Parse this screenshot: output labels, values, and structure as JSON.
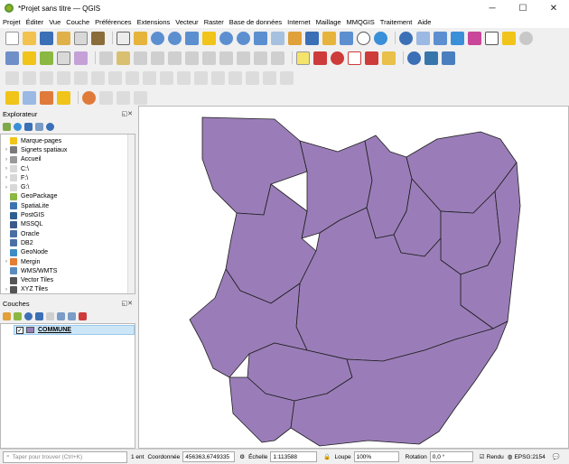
{
  "window": {
    "title": "*Projet sans titre — QGIS",
    "controls": {
      "minimize": "─",
      "maximize": "☐",
      "close": "✕"
    }
  },
  "menu": [
    "Projet",
    "Éditer",
    "Vue",
    "Couche",
    "Préférences",
    "Extensions",
    "Vecteur",
    "Raster",
    "Base de données",
    "Internet",
    "Maillage",
    "MMQGIS",
    "Traitement",
    "Aide"
  ],
  "explorer": {
    "title": "Explorateur",
    "items": [
      {
        "label": "Marque-pages",
        "arrow": "",
        "icon": "star-icon",
        "color": "#f0c419"
      },
      {
        "label": "Signets spatiaux",
        "arrow": "›",
        "icon": "bookmark-icon",
        "color": "#7a7a7a"
      },
      {
        "label": "Accueil",
        "arrow": "›",
        "icon": "home-folder-icon",
        "color": "#9a9a9a"
      },
      {
        "label": "C:\\",
        "arrow": "›",
        "icon": "drive-icon",
        "color": "#d8d8d8"
      },
      {
        "label": "F:\\",
        "arrow": "›",
        "icon": "drive-icon",
        "color": "#d8d8d8"
      },
      {
        "label": "G:\\",
        "arrow": "›",
        "icon": "drive-icon",
        "color": "#d8d8d8"
      },
      {
        "label": "GeoPackage",
        "arrow": "",
        "icon": "geopackage-icon",
        "color": "#8bb842"
      },
      {
        "label": "SpatiaLite",
        "arrow": "",
        "icon": "spatialite-icon",
        "color": "#3d74b0"
      },
      {
        "label": "PostGIS",
        "arrow": "",
        "icon": "postgis-icon",
        "color": "#2f5f8f"
      },
      {
        "label": "MSSQL",
        "arrow": "",
        "icon": "mssql-icon",
        "color": "#3b5a8a"
      },
      {
        "label": "Oracle",
        "arrow": "",
        "icon": "oracle-icon",
        "color": "#4a6fa5"
      },
      {
        "label": "DB2",
        "arrow": "",
        "icon": "db2-icon",
        "color": "#4a6fa5"
      },
      {
        "label": "GeoNode",
        "arrow": "",
        "icon": "geonode-icon",
        "color": "#3c8dc5"
      },
      {
        "label": "Mergin",
        "arrow": "›",
        "icon": "mergin-icon",
        "color": "#e57d32"
      },
      {
        "label": "WMS/WMTS",
        "arrow": "",
        "icon": "wms-icon",
        "color": "#5b8cc0"
      },
      {
        "label": "Vector Tiles",
        "arrow": "",
        "icon": "vector-tiles-icon",
        "color": "#555555"
      },
      {
        "label": "XYZ Tiles",
        "arrow": "›",
        "icon": "xyz-tiles-icon",
        "color": "#555555"
      }
    ]
  },
  "layers_panel": {
    "title": "Couches",
    "layers": [
      {
        "name": "COMMUNE",
        "checked": "✓",
        "fill": "#9a7db8"
      }
    ]
  },
  "panel_buttons": "◱✕",
  "status": {
    "locator_placeholder": "Taper pour trouver (Ctrl+K)",
    "selection": "1 ent",
    "coord_label": "Coordonnée",
    "coord_value": "456363,6749335",
    "scale_label": "Échelle",
    "scale_value": "1:113588",
    "zoom_label": "Loupe",
    "zoom_value": "100%",
    "rotation_label": "Rotation",
    "rotation_value": "0,0 °",
    "render_label": "Rendu",
    "crs": "EPSG:2154"
  },
  "colors": {
    "polygon_fill": "#9a7db8",
    "polygon_stroke": "#1e1e1e",
    "accent": "#589632"
  }
}
